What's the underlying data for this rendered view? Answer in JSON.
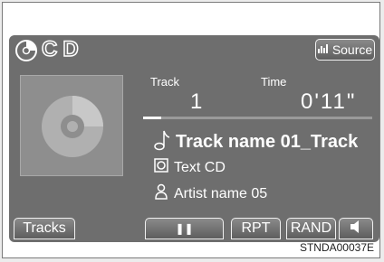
{
  "source": {
    "name": "CD",
    "button_label": "Source"
  },
  "track": {
    "header": "Track",
    "number": "1"
  },
  "time": {
    "header": "Time",
    "value": "0'11\""
  },
  "progress": {
    "fraction": 0.08
  },
  "info": {
    "track_name": "Track name 01_Track",
    "disc_text": "Text CD",
    "artist": "Artist name 05"
  },
  "controls": {
    "tracks_label": "Tracks",
    "pause_symbol": "❚❚",
    "repeat_label": "RPT",
    "random_label": "RAND"
  },
  "footer": {
    "code": "STNDA00037E"
  },
  "colors": {
    "screen": "#6e6e6e",
    "text": "#ffffff",
    "track_bar": "#9a9a9a"
  },
  "icons": [
    "disc-icon",
    "source-icon",
    "music-note-icon",
    "cd-text-icon",
    "artist-icon",
    "speaker-icon"
  ]
}
